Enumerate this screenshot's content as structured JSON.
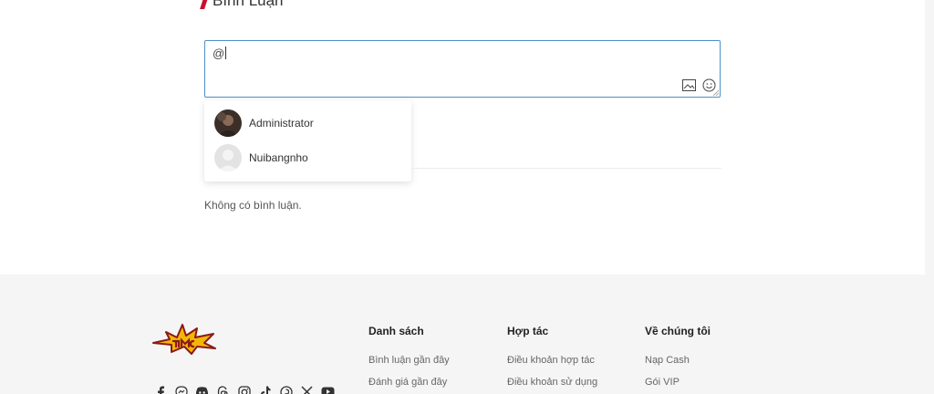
{
  "comments": {
    "heading": "Bình Luận",
    "input_value": "@",
    "empty_text": "Không có bình luận."
  },
  "mentions": [
    {
      "name": "Administrator"
    },
    {
      "name": "Nuibangnho"
    }
  ],
  "footer": {
    "columns": [
      {
        "title": "Danh sách",
        "links": [
          "Bình luận gần đây",
          "Đánh giá gần đây"
        ]
      },
      {
        "title": "Hợp tác",
        "links": [
          "Điều khoản hợp tác",
          "Điều khoản sử dụng"
        ]
      },
      {
        "title": "Về chúng tôi",
        "links": [
          "Nạp Cash",
          "Gói VIP"
        ]
      }
    ],
    "social_icons": [
      "facebook-icon",
      "messenger-icon",
      "discord-icon",
      "threads-icon",
      "instagram-icon",
      "tiktok-icon",
      "pinterest-icon",
      "x-icon",
      "youtube-icon"
    ]
  },
  "colors": {
    "accent": "#c8102e",
    "input_border": "#4a90c8",
    "footer_bg": "#f5f5f5"
  }
}
